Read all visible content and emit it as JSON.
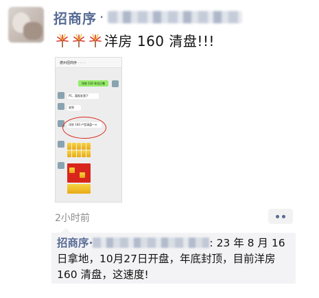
{
  "post": {
    "author": "招商序",
    "author_dot": "·",
    "text": "洋房 160 清盘!!!",
    "emoji_count": 3,
    "time": "2小时前"
  },
  "screenshot": {
    "chat_title": "德州招商序 · · · ·",
    "green_bubble": "洋房 110 车位已售",
    "msg1": "P1，喜报发我下",
    "msg2": "收到",
    "msg3": "洋房 160 户型清盘～✕",
    "msg3_tail": "✕"
  },
  "comment": {
    "author": "招商序",
    "author_dot": "·",
    "tail": ": ",
    "text": "23 年 8 月 16日拿地，10月27日开盘，年底封顶，目前洋房 160 清盘，这速度!"
  },
  "colors": {
    "link": "#576b95",
    "bg": "#ffffff",
    "comment_bg": "#f3f3f5",
    "time": "#8c8c8c"
  },
  "icons": {
    "firework": "firework-emoji",
    "more": "more-dots-icon"
  }
}
